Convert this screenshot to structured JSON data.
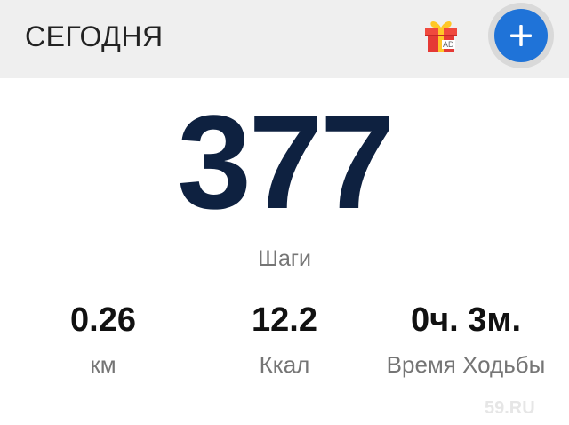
{
  "header": {
    "title": "СЕГОДНЯ",
    "gift_icon": "gift-icon",
    "ad_badge": "AD",
    "add_icon": "plus-icon",
    "accent_color": "#1f73d8"
  },
  "main": {
    "steps_value": "377",
    "steps_label": "Шаги",
    "stats": [
      {
        "value": "0.26",
        "unit": "км"
      },
      {
        "value": "12.2",
        "unit": "Ккал"
      },
      {
        "value": "0ч. 3м.",
        "unit": "Время Ходьбы"
      }
    ]
  },
  "watermark": "59.RU"
}
